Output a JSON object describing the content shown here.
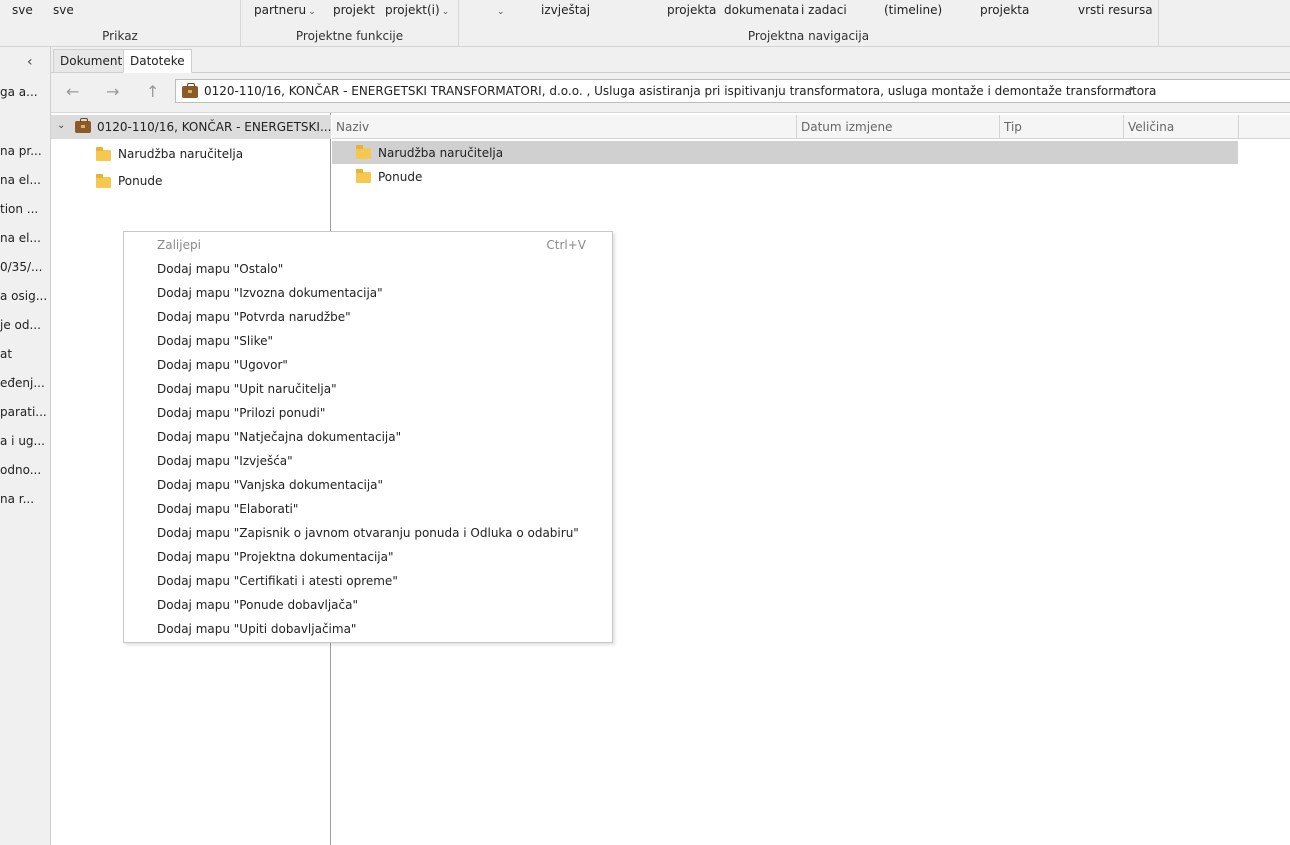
{
  "ribbon": {
    "prikaz": {
      "label": "Prikaz",
      "items": [
        "sve",
        "sve"
      ]
    },
    "funkcije": {
      "label": "Projektne funkcije",
      "items": [
        "partneru",
        "projekt",
        "projekt(i)"
      ]
    },
    "navigacija": {
      "label": "Projektna navigacija",
      "items": [
        "izvještaj",
        "projekta",
        "dokumenata",
        "i zadaci",
        "(timeline)",
        "projekta",
        "vrsti resursa"
      ]
    }
  },
  "left_panel": {
    "items": [
      "ga a...",
      "na pr...",
      "na el...",
      "tion ...",
      "na el...",
      "0/35/...",
      "a osig...",
      "je od...",
      "at",
      "eđenj...",
      "parati...",
      "a i ug...",
      "odno...",
      "na r..."
    ]
  },
  "tabs": [
    {
      "label": "Dokumenti",
      "active": false
    },
    {
      "label": "Datoteke",
      "active": true
    }
  ],
  "address": {
    "path": "0120-110/16, KONČAR - ENERGETSKI TRANSFORMATORI, d.o.o. , Usluga asistiranja pri ispitivanju transformatora, usluga montaže i demontaže transformatora"
  },
  "tree": {
    "root": "0120-110/16, KONČAR - ENERGETSKI...",
    "children": [
      "Narudžba naručitelja",
      "Ponude"
    ]
  },
  "filelist": {
    "columns": [
      "Naziv",
      "Datum izmjene",
      "Tip",
      "Veličina"
    ],
    "rows": [
      {
        "name": "Narudžba naručitelja",
        "selected": true
      },
      {
        "name": "Ponude",
        "selected": false
      }
    ]
  },
  "context_menu": {
    "paste": {
      "label": "Zalijepi",
      "shortcut": "Ctrl+V",
      "disabled": true
    },
    "items": [
      "Dodaj mapu \"Ostalo\"",
      "Dodaj mapu \"Izvozna dokumentacija\"",
      "Dodaj mapu \"Potvrda narudžbe\"",
      "Dodaj mapu \"Slike\"",
      "Dodaj mapu \"Ugovor\"",
      "Dodaj mapu \"Upit naručitelja\"",
      "Dodaj mapu \"Prilozi ponudi\"",
      "Dodaj mapu \"Natječajna dokumentacija\"",
      "Dodaj mapu \"Izvješća\"",
      "Dodaj mapu \"Vanjska dokumentacija\"",
      "Dodaj mapu \"Elaborati\"",
      "Dodaj mapu \"Zapisnik o javnom otvaranju ponuda i Odluka o odabiru\"",
      "Dodaj mapu \"Projektna dokumentacija\"",
      "Dodaj mapu \"Certifikati i atesti opreme\"",
      "Dodaj mapu \"Ponude dobavljača\"",
      "Dodaj mapu \"Upiti dobavljačima\""
    ]
  },
  "icons": {
    "back": "arrow-left-icon",
    "forward": "arrow-right-icon",
    "up": "arrow-up-icon",
    "collapse": "chevron-left-icon",
    "project": "briefcase-icon",
    "folder": "folder-icon"
  },
  "colors": {
    "ribbon_bg": "#f0f0f0",
    "selection": "#d0d0d0",
    "folder": "#f5c94f"
  }
}
